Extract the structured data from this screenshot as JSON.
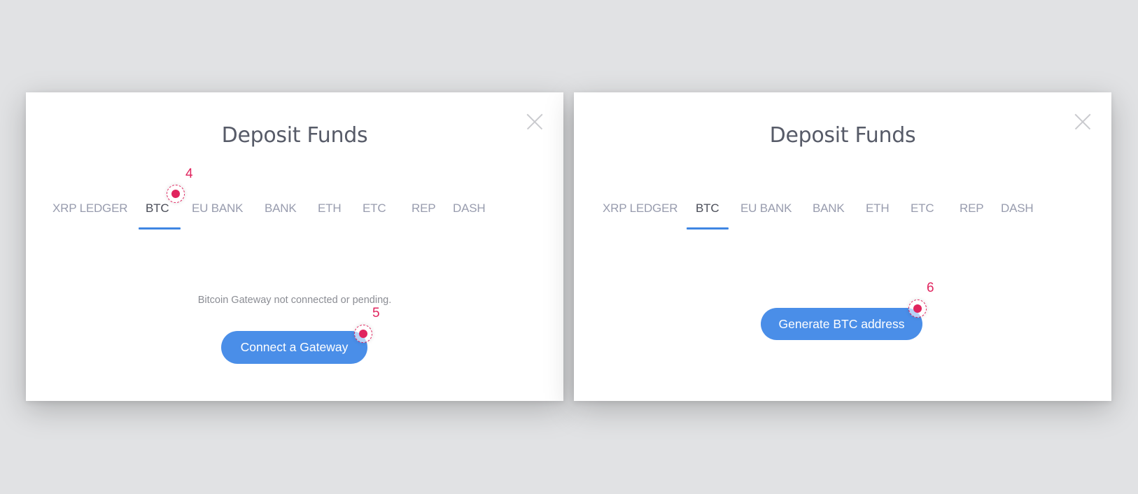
{
  "panels": [
    {
      "title": "Deposit Funds",
      "tabs": [
        {
          "label": "XRP LEDGER",
          "active": false
        },
        {
          "label": "BTC",
          "active": true
        },
        {
          "label": "EU BANK",
          "active": false
        },
        {
          "label": "BANK",
          "active": false
        },
        {
          "label": "ETH",
          "active": false
        },
        {
          "label": "ETC",
          "active": false
        },
        {
          "label": "REP",
          "active": false
        },
        {
          "label": "DASH",
          "active": false
        }
      ],
      "status_text": "Bitcoin Gateway not connected or pending.",
      "button_label": "Connect a Gateway",
      "close_icon": "close-icon",
      "annotations": [
        {
          "number": "4",
          "target": "BTC tab"
        },
        {
          "number": "5",
          "target": "Connect a Gateway button"
        }
      ]
    },
    {
      "title": "Deposit Funds",
      "tabs": [
        {
          "label": "XRP LEDGER",
          "active": false
        },
        {
          "label": "BTC",
          "active": true
        },
        {
          "label": "EU BANK",
          "active": false
        },
        {
          "label": "BANK",
          "active": false
        },
        {
          "label": "ETH",
          "active": false
        },
        {
          "label": "ETC",
          "active": false
        },
        {
          "label": "REP",
          "active": false
        },
        {
          "label": "DASH",
          "active": false
        }
      ],
      "button_label": "Generate BTC address",
      "close_icon": "close-icon",
      "annotations": [
        {
          "number": "6",
          "target": "Generate BTC address button"
        }
      ]
    }
  ],
  "colors": {
    "accent": "#4a8ee8",
    "tab_underline": "#3f86e3",
    "annotation": "#e0245e",
    "tab_inactive": "#989cae",
    "tab_active": "#4a4d58",
    "title": "#575b68",
    "background": "#e1e2e4"
  }
}
